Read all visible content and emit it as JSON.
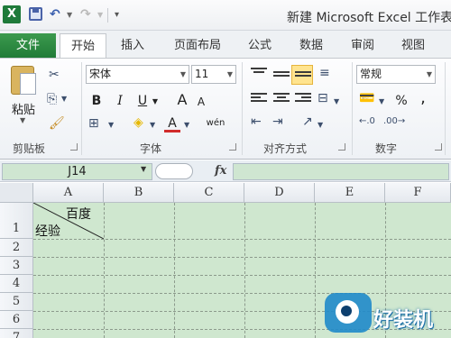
{
  "titlebar": {
    "window_title": "新建 Microsoft Excel 工作表"
  },
  "tabs": {
    "file": "文件",
    "items": [
      "开始",
      "插入",
      "页面布局",
      "公式",
      "数据",
      "审阅",
      "视图"
    ],
    "active": "开始"
  },
  "ribbon": {
    "clipboard": {
      "group_label": "剪贴板",
      "paste_label": "粘贴"
    },
    "font": {
      "group_label": "字体",
      "font_name": "宋体",
      "font_size": "11",
      "bold": "B",
      "italic": "I",
      "underline": "U",
      "grow": "A",
      "shrink": "A",
      "phonetic": "wén"
    },
    "alignment": {
      "group_label": "对齐方式"
    },
    "number": {
      "group_label": "数字",
      "format": "常规",
      "percent": "%",
      "comma": ","
    }
  },
  "formula_bar": {
    "name_box": "J14",
    "fx": "fx"
  },
  "sheet": {
    "columns": [
      "A",
      "B",
      "C",
      "D",
      "E",
      "F"
    ],
    "rows": [
      "1",
      "2",
      "3",
      "4",
      "5",
      "6",
      "7"
    ],
    "cell_a1_top_right": "百度",
    "cell_a1_bottom_left": "经验"
  },
  "watermark": {
    "text": "好装机"
  }
}
